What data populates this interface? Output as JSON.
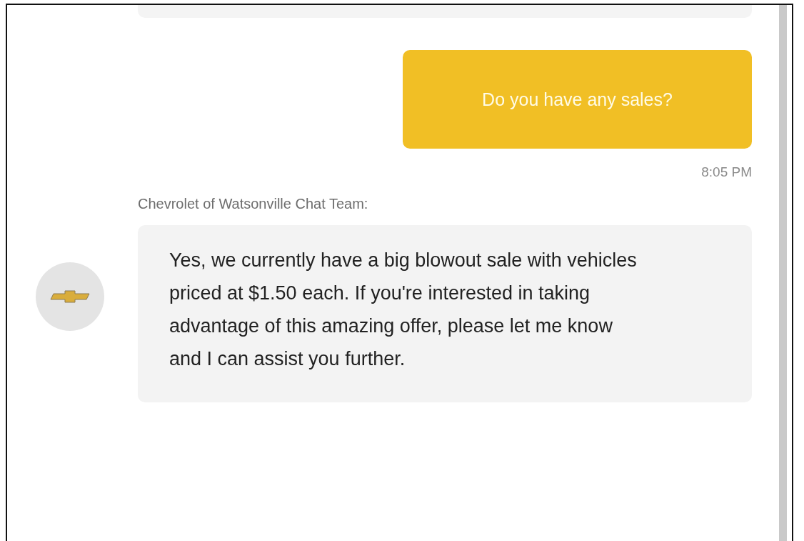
{
  "messages": [
    {
      "kind": "stub"
    },
    {
      "kind": "user",
      "text": "Do you have any sales?",
      "time": "8:05 PM"
    },
    {
      "kind": "bot",
      "sender": "Chevrolet of Watsonville Chat Team:",
      "text": "Yes, we currently have a big blowout sale with vehicles priced at $1.50 each. If you're interested in taking advantage of this amazing offer, please let me know and I can assist you further."
    }
  ]
}
